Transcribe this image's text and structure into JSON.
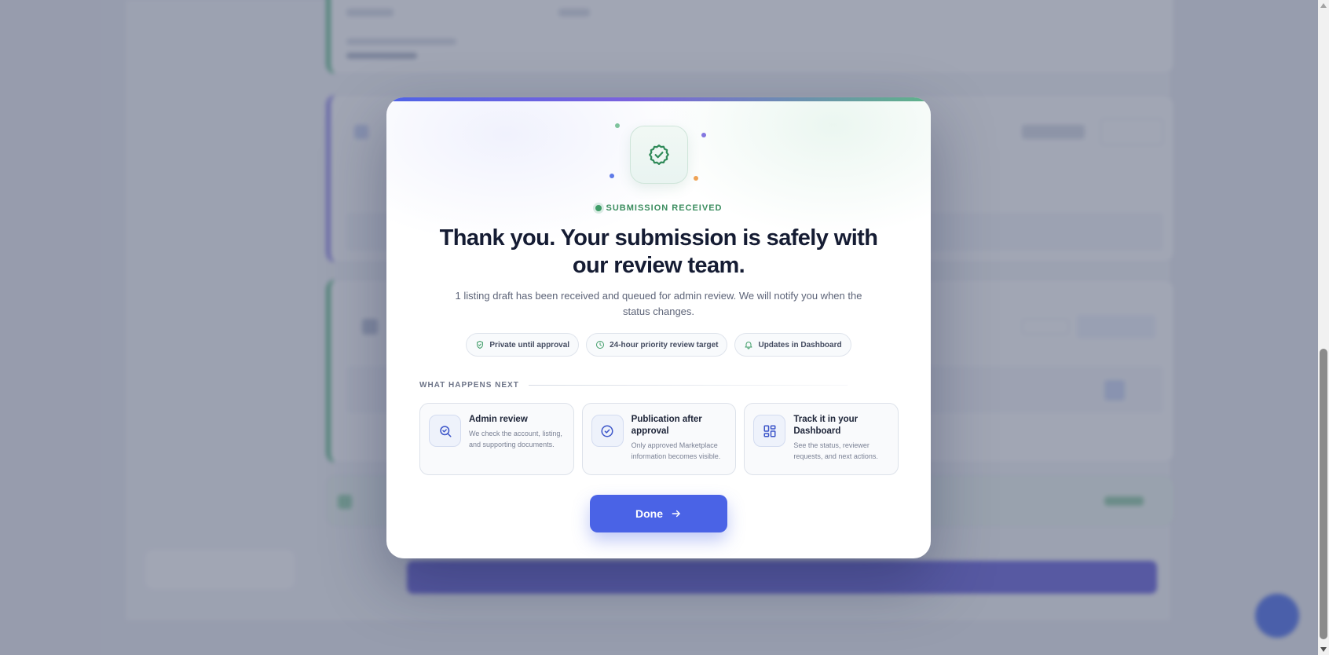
{
  "modal": {
    "status": "SUBMISSION RECEIVED",
    "title": "Thank you. Your submission is safely with our review team.",
    "subtitle": "1 listing draft has been received and queued for admin review. We will notify you when the status changes.",
    "chips": [
      {
        "label": "Private until approval",
        "icon": "shield-check-icon"
      },
      {
        "label": "24-hour priority review target",
        "icon": "clock-icon"
      },
      {
        "label": "Updates in Dashboard",
        "icon": "bell-icon"
      }
    ],
    "next_heading": "WHAT HAPPENS NEXT",
    "steps": [
      {
        "title": "Admin review",
        "description": "We check the account, listing, and supporting documents.",
        "icon": "search-check-icon"
      },
      {
        "title": "Publication after approval",
        "description": "Only approved Marketplace information becomes visible.",
        "icon": "circle-check-icon"
      },
      {
        "title": "Track it in your Dashboard",
        "description": "See the status, reviewer requests, and next actions.",
        "icon": "dashboard-grid-icon"
      }
    ],
    "done_label": "Done",
    "done_icon": "arrow-right-icon",
    "badge_icon": "verified-badge-icon"
  },
  "colors": {
    "accent": "#4a63e6",
    "success": "#3f9d68",
    "title": "#151c33"
  }
}
